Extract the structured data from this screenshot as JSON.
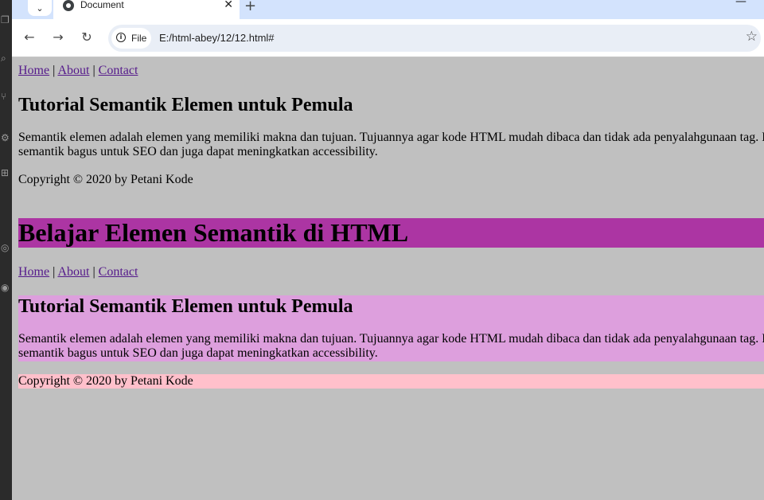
{
  "browser": {
    "tab_title": "Document",
    "tab_close": "✕",
    "new_tab": "+",
    "minimize": "—",
    "tab_list": "⌄",
    "site_chip_label": "File",
    "url": "E:/html-abey/12/12.html#",
    "nav": {
      "back": "←",
      "forward": "→",
      "reload": "↻",
      "star": "☆"
    }
  },
  "page": {
    "nav_links": [
      "Home",
      "About",
      "Contact"
    ],
    "nav_separator": "|",
    "article_title": "Tutorial Semantik Elemen untuk Pemula",
    "article_line1": "Semantik elemen adalah elemen yang memiliki makna dan tujuan. Tujuannya agar kode HTML mudah dibaca dan tidak ada penyalahgunaan tag. Elemen",
    "article_line2": "semantik bagus untuk SEO dan juga dapat meningkatkan accessibility.",
    "copyright": "Copyright © 2020 by Petani Kode",
    "main_heading": "Belajar Elemen Semantik di HTML"
  },
  "colors": {
    "page_background": "#c0c0c0",
    "header_background": "#ac35a3",
    "article_background": "#dd9fdd",
    "footer_background": "#ffc0cb",
    "link": "#551a8b"
  }
}
